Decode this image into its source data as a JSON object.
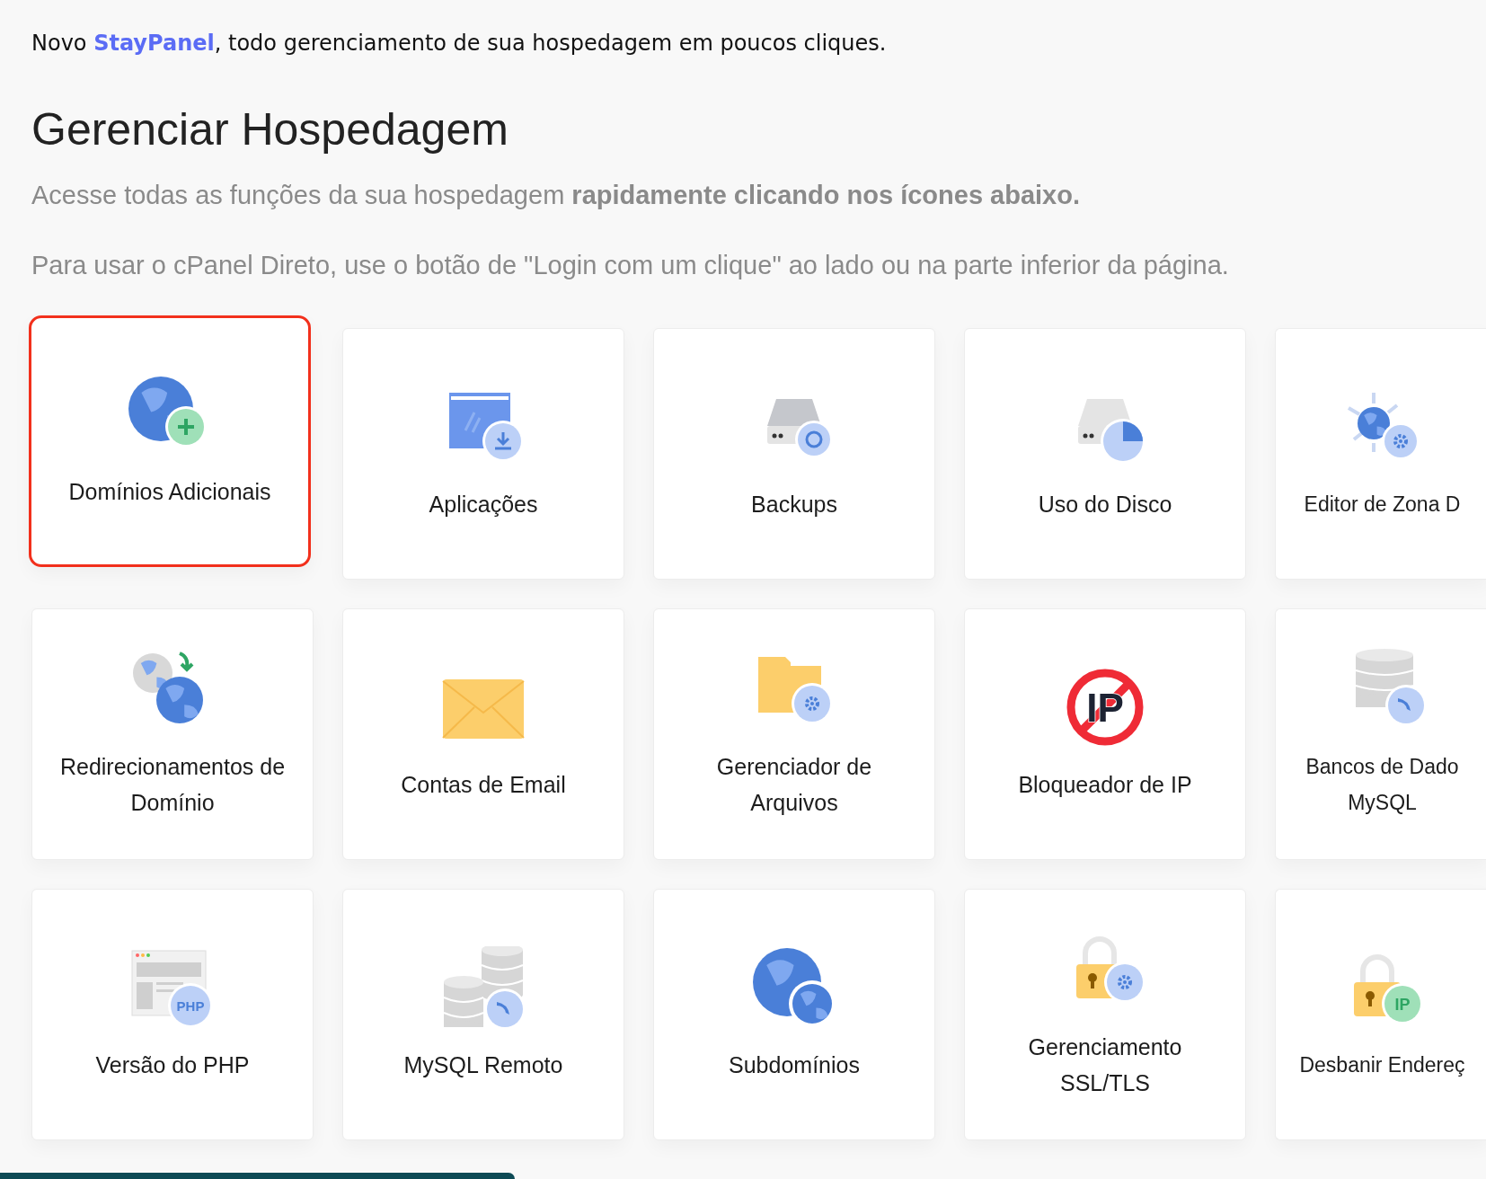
{
  "intro": "Novo **StayPanel**, todo gerenciamento de sua hospedagem em poucos cliques.",
  "title": "Gerenciar Hospedagem",
  "subtitle": "Acesse todas as funções da sua hospedagem **rapidamente clicando nos ícones abaixo.**",
  "note": "Para usar o cPanel Direto, use o botão de \"Login com um clique\" ao lado ou na parte inferior da página.",
  "tiles": [
    {
      "label": "Domínios Adicionais",
      "selected": true
    },
    {
      "label": "Aplicações",
      "selected": false
    },
    {
      "label": "Backups",
      "selected": false
    },
    {
      "label": "Uso do Disco",
      "selected": false
    },
    {
      "label": "Editor de Zona D",
      "selected": false
    },
    {
      "label": "Redirecionamentos de Domínio",
      "selected": false
    },
    {
      "label": "Contas de Email",
      "selected": false
    },
    {
      "label": "Gerenciador de Arquivos",
      "selected": false
    },
    {
      "label": "Bloqueador de IP",
      "selected": false,
      "icon_label": "IP"
    },
    {
      "label": "Bancos de Dado MySQL",
      "selected": false
    },
    {
      "label": "Versão do PHP",
      "selected": false,
      "icon_label": "PHP"
    },
    {
      "label": "MySQL Remoto",
      "selected": false
    },
    {
      "label": "Subdomínios",
      "selected": false
    },
    {
      "label": "Gerenciamento SSL/TLS",
      "selected": false
    },
    {
      "label": "Desbanir Endereç",
      "selected": false,
      "icon_label": "IP"
    }
  ]
}
